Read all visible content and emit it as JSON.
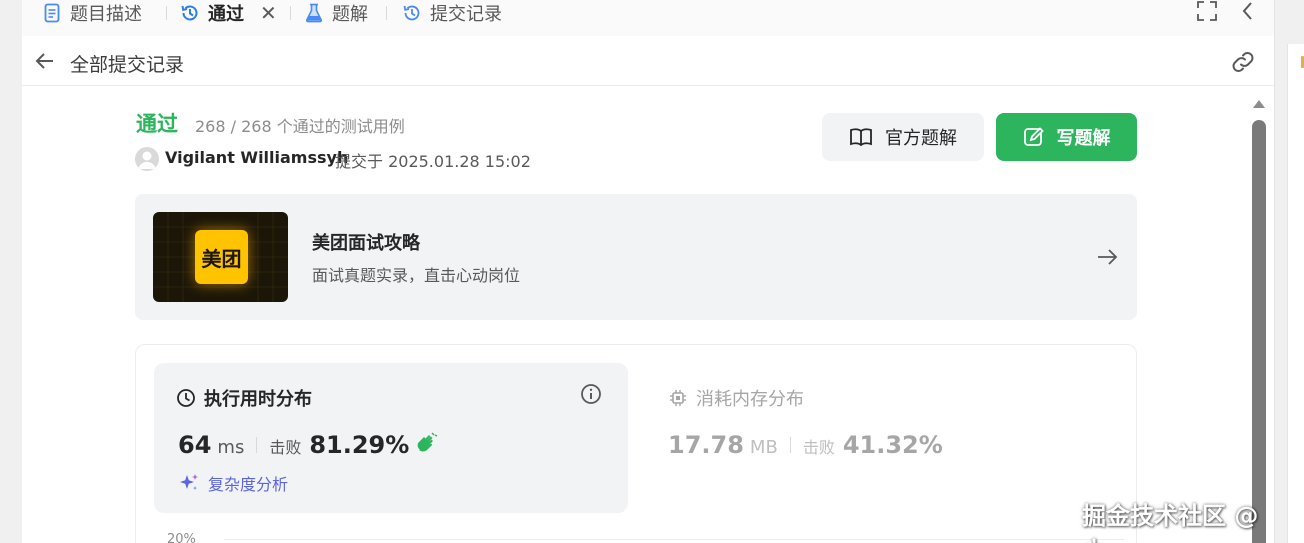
{
  "tabs": [
    {
      "label": "题目描述",
      "icon": "document-icon",
      "active": false
    },
    {
      "label": "通过",
      "icon": "history-icon",
      "active": true
    },
    {
      "label": "题解",
      "icon": "flask-icon",
      "active": false
    },
    {
      "label": "提交记录",
      "icon": "history-icon",
      "active": false
    }
  ],
  "tab_close_glyph": "✕",
  "subheader": {
    "title": "全部提交记录"
  },
  "submission": {
    "status": "通过",
    "cases": "268 / 268 个通过的测试用例",
    "user": "Vigilant Williamssyh",
    "submitted_at": "提交于 2025.01.28 15:02"
  },
  "buttons": {
    "official": "官方题解",
    "write": "写题解"
  },
  "banner": {
    "logo_text": "美团",
    "title": "美团面试攻略",
    "subtitle": "面试真题实录，直击心动岗位"
  },
  "runtime": {
    "title": "执行用时分布",
    "value": "64",
    "unit": "ms",
    "beat_label": "击败",
    "beat_pct": "81.29%",
    "analyze_label": "复杂度分析"
  },
  "memory": {
    "title": "消耗内存分布",
    "value": "17.78",
    "unit": "MB",
    "beat_label": "击败",
    "beat_pct": "41.32%"
  },
  "chart": {
    "axis_label": "20%"
  },
  "watermark": "掘金技术社区 @ 小u",
  "colors": {
    "accent": "#2db55d",
    "link": "#5b66e0",
    "muted": "#a6a6a6"
  }
}
